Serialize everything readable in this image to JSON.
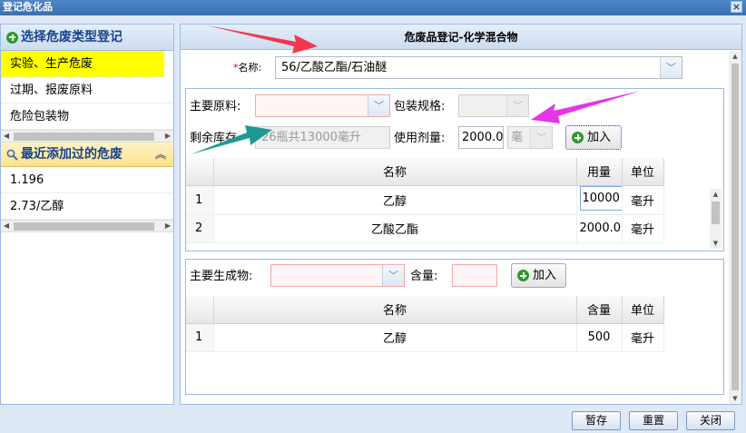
{
  "window": {
    "title": "登记危化品",
    "close_glyph": "×"
  },
  "left": {
    "header": "选择危废类型登记",
    "items": [
      {
        "label": "实验、生产危废"
      },
      {
        "label": "过期、报废原料"
      },
      {
        "label": "危险包装物"
      }
    ],
    "recent_header": "最近添加过的危废",
    "recent_items": [
      {
        "label": "1.196"
      },
      {
        "label": "2.73/乙醇"
      }
    ]
  },
  "main": {
    "title": "危废品登记-化学混合物",
    "name_label": "名称:",
    "name_value": "56/乙酸乙酯/石油醚",
    "materials": {
      "raw_label": "主要原料:",
      "raw_value": "",
      "spec_label": "包装规格:",
      "spec_value": "",
      "stock_label": "剩余库存",
      "stock_value": "26瓶共13000毫升",
      "dose_label": "使用剂量:",
      "dose_value": "2000.0",
      "unit_value": "毫",
      "add_label": "加入",
      "columns": [
        "名称",
        "用量",
        "单位"
      ],
      "rows": [
        {
          "no": "1",
          "name": "乙醇",
          "qty": "10000",
          "unit": "毫升"
        },
        {
          "no": "2",
          "name": "乙酸乙酯",
          "qty": "2000.00",
          "unit": "毫升"
        }
      ]
    },
    "products": {
      "product_label": "主要生成物:",
      "product_value": "",
      "amount_label": "含量:",
      "amount_value": "",
      "add_label": "加入",
      "columns": [
        "名称",
        "含量",
        "单位"
      ],
      "rows": [
        {
          "no": "1",
          "name": "乙醇",
          "qty": "500",
          "unit": "毫升"
        }
      ]
    }
  },
  "footer": {
    "save_label": "暂存",
    "reset_label": "重置",
    "close_label": "关闭"
  },
  "colors": {
    "arrow_red": "#f0384f",
    "arrow_magenta": "#e635e6",
    "arrow_teal": "#1f9a93",
    "selected_bg": "#ffff00"
  }
}
